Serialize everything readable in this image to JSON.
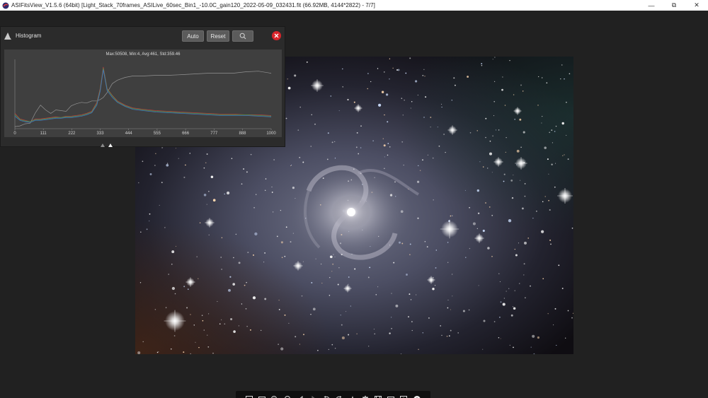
{
  "window": {
    "title": "ASIFitsView_V1.5.6 (64bit) [Light_Stack_70frames_ASILive_60sec_Bin1_-10.0C_gain120_2022-05-09_032431.fit (66.92MB, 4144*2822) - 7/7]",
    "minimize_label": "—",
    "maximize_label": "⧉",
    "close_label": "✕"
  },
  "histogram": {
    "title": "Histogram",
    "auto_label": "Auto",
    "reset_label": "Reset",
    "stats": "Max:50508, Min:4, Avg:461, Std:359.46",
    "x_ticks": [
      "0",
      "111",
      "222",
      "333",
      "444",
      "555",
      "666",
      "777",
      "888",
      "1000"
    ],
    "series_colors": {
      "red": "#c8433f",
      "green": "#3f9f4e",
      "blue": "#4672c8",
      "luminance": "#d8d8d8"
    }
  },
  "chart_data": {
    "type": "line",
    "x": [
      0,
      20,
      40,
      60,
      80,
      100,
      120,
      140,
      160,
      180,
      200,
      220,
      240,
      260,
      280,
      300,
      320,
      333,
      345,
      360,
      380,
      400,
      430,
      460,
      500,
      550,
      600,
      650,
      700,
      750,
      800,
      850,
      900,
      950,
      1000
    ],
    "series": [
      {
        "values": [
          3,
          4,
          7,
          8,
          23,
          34,
          27,
          22,
          27,
          26,
          25,
          33,
          36,
          38,
          37,
          40,
          40,
          42,
          45,
          52,
          65,
          70,
          74,
          76,
          76,
          77,
          77,
          78,
          79,
          80,
          80,
          80,
          82,
          83,
          80
        ]
      },
      {
        "values": [
          22,
          14,
          12,
          10,
          14,
          14,
          15,
          16,
          17,
          16,
          18,
          18,
          19,
          20,
          22,
          25,
          38,
          58,
          89,
          58,
          48,
          40,
          34,
          30,
          28,
          26,
          25,
          24,
          23,
          22,
          21,
          21,
          20,
          20,
          19
        ]
      },
      {
        "values": [
          20,
          13,
          11,
          10,
          13,
          13,
          14,
          15,
          16,
          16,
          17,
          17,
          18,
          19,
          21,
          24,
          36,
          56,
          87,
          57,
          47,
          39,
          33,
          29,
          27,
          25,
          24,
          23,
          22,
          21,
          20,
          20,
          20,
          19,
          18
        ]
      },
      {
        "values": [
          18,
          12,
          10,
          9,
          12,
          12,
          13,
          14,
          15,
          15,
          16,
          16,
          17,
          18,
          20,
          23,
          34,
          54,
          85,
          55,
          45,
          38,
          32,
          28,
          26,
          24,
          23,
          22,
          21,
          20,
          19,
          19,
          19,
          18,
          17
        ]
      }
    ],
    "xlim": [
      0,
      1000
    ],
    "xticks": [
      "0",
      "111",
      "222",
      "333",
      "444",
      "555",
      "666",
      "777",
      "888",
      "1000"
    ],
    "grid": false
  },
  "toolbar": {
    "icons": [
      "fit-to-window-icon",
      "actual-size-icon",
      "zoom-in-icon",
      "zoom-out-icon",
      "previous-icon",
      "next-icon",
      "rotate-left-icon",
      "rotate-right-icon",
      "histogram-icon",
      "delete-icon",
      "save-icon",
      "compare-icon",
      "info-icon",
      "add-icon"
    ]
  },
  "viewer": {
    "image_name": "m101-pinwheel-galaxy-image"
  }
}
